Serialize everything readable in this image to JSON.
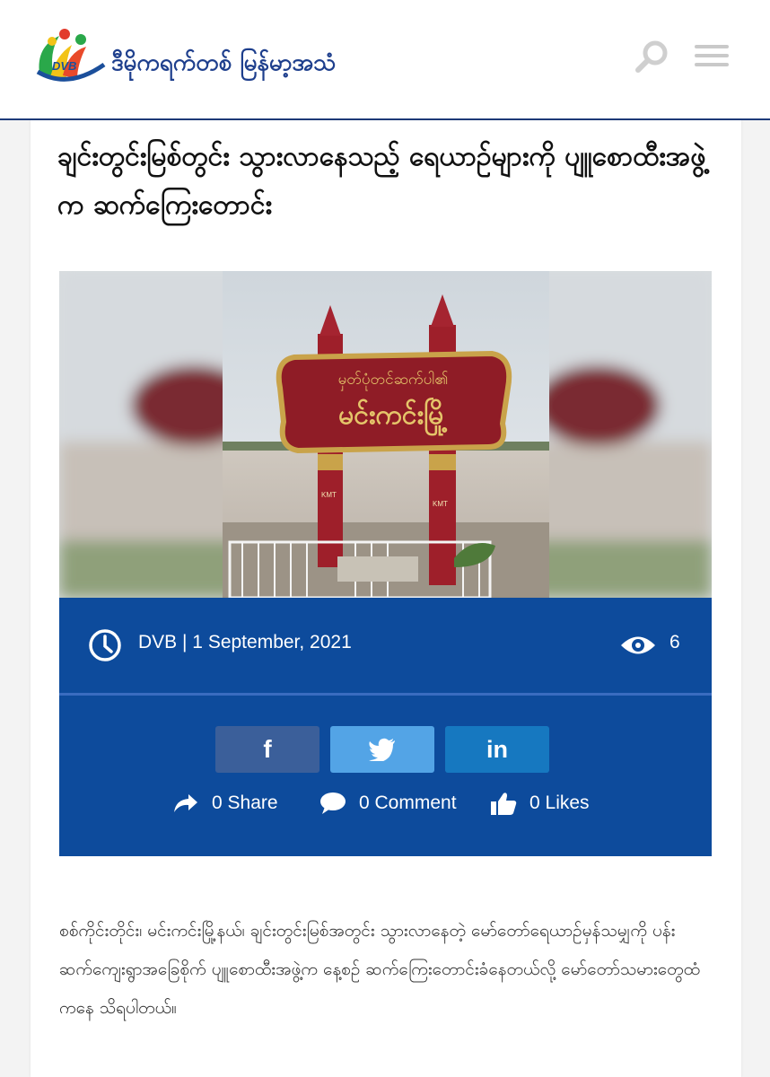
{
  "header": {
    "logo_text": "DVB",
    "brand_name": "ဒီမိုကရက်တစ် မြန်မာ့အသံ",
    "search_icon": "search-icon",
    "menu_icon": "hamburger-menu-icon",
    "colors": {
      "brand": "#1e3f8d",
      "header_line": "#1e3b7a"
    }
  },
  "article": {
    "title": "ချင်းတွင်းမြစ်တွင်း သွားလာနေသည့် ရေယာဉ်များကို ပျူစောထီးအဖွဲ့က ဆက်ကြေးတောင်း",
    "image": {
      "sign_top_text": "မှတ်ပုံတင်ဆက်ပါ၏",
      "sign_main_text": "မင်းကင်းမြို့",
      "pillar_label_left": "KMT",
      "pillar_label_right": "KMT"
    },
    "meta": {
      "author_date": "DVB | 1 September, 2021",
      "views": "6",
      "clock_icon": "clock-icon",
      "eye_icon": "eye-icon"
    },
    "share": {
      "facebook_label": "f",
      "linkedin_label": "in",
      "share_count": "0 Share",
      "comment_count": "0 Comment",
      "likes_count": "0 Likes",
      "colors": {
        "facebook": "#3b5f9a",
        "twitter": "#53a4e6",
        "linkedin": "#1678c0",
        "panel": "#0d4b9c"
      }
    },
    "body": "စစ်ကိုင်းတိုင်း၊ မင်းကင်းမြို့နယ်၊ ချင်းတွင်းမြစ်အတွင်း သွားလာနေတဲ့ မော်တော်ရေယာဉ်မှန်သမျှကို ပန်းဆက်ကျေးရွာအခြေစိုက် ပျူစောထီးအဖွဲ့က နေ့စဉ် ဆက်ကြေးတောင်းခံနေတယ်လို့ မော်တော်သမားတွေထံကနေ သိရပါတယ်။"
  }
}
